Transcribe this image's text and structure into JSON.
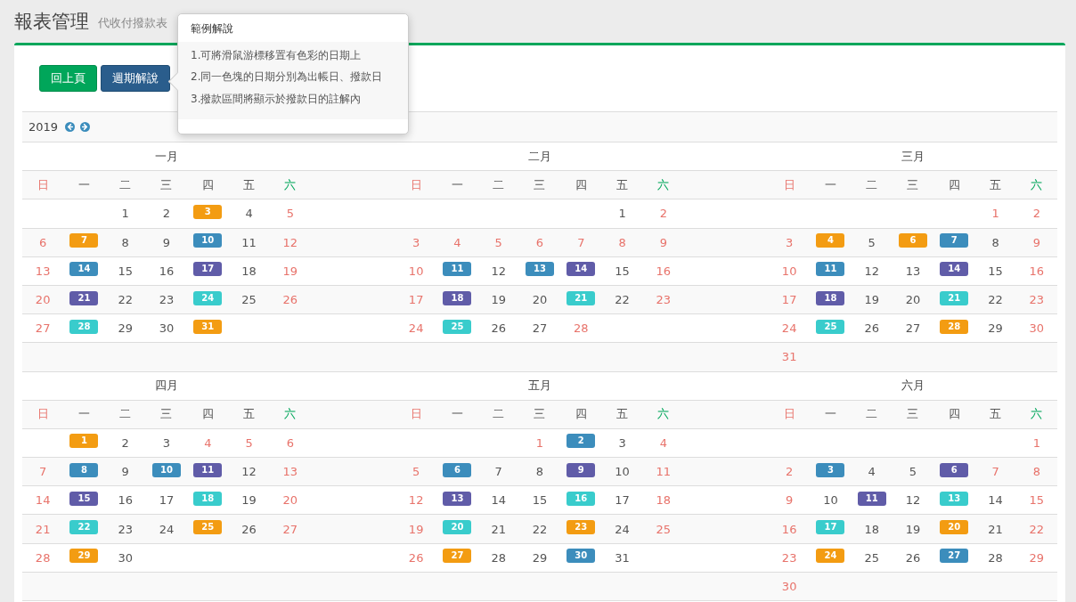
{
  "header": {
    "title": "報表管理",
    "subtitle": "代收付撥款表"
  },
  "buttons": [
    {
      "label": "回上頁",
      "kind": "back"
    },
    {
      "label": "週期解說",
      "kind": "info"
    }
  ],
  "popover": {
    "title": "範例解說",
    "items": [
      "1.可將滑鼠游標移置有色彩的日期上",
      "2.同一色塊的日期分別為出帳日、撥款日",
      "3.撥款區間將顯示於撥款日的註解內"
    ]
  },
  "year": "2019",
  "months": [
    {
      "title": "一月",
      "weekdays": [
        {
          "label": "日",
          "kind": "sun"
        },
        {
          "label": "一",
          "kind": "work"
        },
        {
          "label": "二",
          "kind": "work"
        },
        {
          "label": "三",
          "kind": "work"
        },
        {
          "label": "四",
          "kind": "work"
        },
        {
          "label": "五",
          "kind": "work"
        },
        {
          "label": "六",
          "kind": "sat"
        }
      ],
      "weeks": [
        [
          {
            "kind": "blank"
          },
          {
            "kind": "blank"
          },
          {
            "kind": "day",
            "day": "1",
            "holiday": false
          },
          {
            "kind": "day",
            "day": "2",
            "holiday": false
          },
          {
            "kind": "day",
            "day": "3",
            "holiday": false,
            "color": "#f39c12"
          },
          {
            "kind": "day",
            "day": "4",
            "holiday": false
          },
          {
            "kind": "day",
            "day": "5",
            "holiday": true
          }
        ],
        [
          {
            "kind": "day",
            "day": "6",
            "holiday": true
          },
          {
            "kind": "day",
            "day": "7",
            "holiday": false,
            "color": "#f39c12"
          },
          {
            "kind": "day",
            "day": "8",
            "holiday": false
          },
          {
            "kind": "day",
            "day": "9",
            "holiday": false
          },
          {
            "kind": "day",
            "day": "10",
            "holiday": false,
            "color": "#3c8dbc"
          },
          {
            "kind": "day",
            "day": "11",
            "holiday": false
          },
          {
            "kind": "day",
            "day": "12",
            "holiday": true
          }
        ],
        [
          {
            "kind": "day",
            "day": "13",
            "holiday": true
          },
          {
            "kind": "day",
            "day": "14",
            "holiday": false,
            "color": "#3c8dbc"
          },
          {
            "kind": "day",
            "day": "15",
            "holiday": false
          },
          {
            "kind": "day",
            "day": "16",
            "holiday": false
          },
          {
            "kind": "day",
            "day": "17",
            "holiday": false,
            "color": "#605ca8"
          },
          {
            "kind": "day",
            "day": "18",
            "holiday": false
          },
          {
            "kind": "day",
            "day": "19",
            "holiday": true
          }
        ],
        [
          {
            "kind": "day",
            "day": "20",
            "holiday": true
          },
          {
            "kind": "day",
            "day": "21",
            "holiday": false,
            "color": "#605ca8"
          },
          {
            "kind": "day",
            "day": "22",
            "holiday": false
          },
          {
            "kind": "day",
            "day": "23",
            "holiday": false
          },
          {
            "kind": "day",
            "day": "24",
            "holiday": false,
            "color": "#39cccc"
          },
          {
            "kind": "day",
            "day": "25",
            "holiday": false
          },
          {
            "kind": "day",
            "day": "26",
            "holiday": true
          }
        ],
        [
          {
            "kind": "day",
            "day": "27",
            "holiday": true
          },
          {
            "kind": "day",
            "day": "28",
            "holiday": false,
            "color": "#39cccc"
          },
          {
            "kind": "day",
            "day": "29",
            "holiday": false
          },
          {
            "kind": "day",
            "day": "30",
            "holiday": false
          },
          {
            "kind": "day",
            "day": "31",
            "holiday": false,
            "color": "#f39c12"
          }
        ]
      ]
    },
    {
      "title": "二月",
      "weekdays": [
        {
          "label": "日",
          "kind": "sun"
        },
        {
          "label": "一",
          "kind": "work"
        },
        {
          "label": "二",
          "kind": "work"
        },
        {
          "label": "三",
          "kind": "work"
        },
        {
          "label": "四",
          "kind": "work"
        },
        {
          "label": "五",
          "kind": "work"
        },
        {
          "label": "六",
          "kind": "sat"
        }
      ],
      "weeks": [
        [
          {
            "kind": "blank"
          },
          {
            "kind": "blank"
          },
          {
            "kind": "blank"
          },
          {
            "kind": "blank"
          },
          {
            "kind": "blank"
          },
          {
            "kind": "day",
            "day": "1",
            "holiday": false
          },
          {
            "kind": "day",
            "day": "2",
            "holiday": true
          }
        ],
        [
          {
            "kind": "day",
            "day": "3",
            "holiday": true
          },
          {
            "kind": "day",
            "day": "4",
            "holiday": true
          },
          {
            "kind": "day",
            "day": "5",
            "holiday": true
          },
          {
            "kind": "day",
            "day": "6",
            "holiday": true
          },
          {
            "kind": "day",
            "day": "7",
            "holiday": true
          },
          {
            "kind": "day",
            "day": "8",
            "holiday": true
          },
          {
            "kind": "day",
            "day": "9",
            "holiday": true
          }
        ],
        [
          {
            "kind": "day",
            "day": "10",
            "holiday": true
          },
          {
            "kind": "day",
            "day": "11",
            "holiday": false,
            "color": "#3c8dbc"
          },
          {
            "kind": "day",
            "day": "12",
            "holiday": false
          },
          {
            "kind": "day",
            "day": "13",
            "holiday": false,
            "color": "#3c8dbc"
          },
          {
            "kind": "day",
            "day": "14",
            "holiday": false,
            "color": "#605ca8"
          },
          {
            "kind": "day",
            "day": "15",
            "holiday": false
          },
          {
            "kind": "day",
            "day": "16",
            "holiday": true
          }
        ],
        [
          {
            "kind": "day",
            "day": "17",
            "holiday": true
          },
          {
            "kind": "day",
            "day": "18",
            "holiday": false,
            "color": "#605ca8"
          },
          {
            "kind": "day",
            "day": "19",
            "holiday": false
          },
          {
            "kind": "day",
            "day": "20",
            "holiday": false
          },
          {
            "kind": "day",
            "day": "21",
            "holiday": false,
            "color": "#39cccc"
          },
          {
            "kind": "day",
            "day": "22",
            "holiday": false
          },
          {
            "kind": "day",
            "day": "23",
            "holiday": true
          }
        ],
        [
          {
            "kind": "day",
            "day": "24",
            "holiday": true
          },
          {
            "kind": "day",
            "day": "25",
            "holiday": false,
            "color": "#39cccc"
          },
          {
            "kind": "day",
            "day": "26",
            "holiday": false
          },
          {
            "kind": "day",
            "day": "27",
            "holiday": false
          },
          {
            "kind": "day",
            "day": "28",
            "holiday": true
          }
        ]
      ]
    },
    {
      "title": "三月",
      "weekdays": [
        {
          "label": "日",
          "kind": "sun"
        },
        {
          "label": "一",
          "kind": "work"
        },
        {
          "label": "二",
          "kind": "work"
        },
        {
          "label": "三",
          "kind": "work"
        },
        {
          "label": "四",
          "kind": "work"
        },
        {
          "label": "五",
          "kind": "work"
        },
        {
          "label": "六",
          "kind": "sat"
        }
      ],
      "weeks": [
        [
          {
            "kind": "blank"
          },
          {
            "kind": "blank"
          },
          {
            "kind": "blank"
          },
          {
            "kind": "blank"
          },
          {
            "kind": "blank"
          },
          {
            "kind": "day",
            "day": "1",
            "holiday": true
          },
          {
            "kind": "day",
            "day": "2",
            "holiday": true
          }
        ],
        [
          {
            "kind": "day",
            "day": "3",
            "holiday": true
          },
          {
            "kind": "day",
            "day": "4",
            "holiday": false,
            "color": "#f39c12"
          },
          {
            "kind": "day",
            "day": "5",
            "holiday": false
          },
          {
            "kind": "day",
            "day": "6",
            "holiday": false,
            "color": "#f39c12"
          },
          {
            "kind": "day",
            "day": "7",
            "holiday": false,
            "color": "#3c8dbc"
          },
          {
            "kind": "day",
            "day": "8",
            "holiday": false
          },
          {
            "kind": "day",
            "day": "9",
            "holiday": true
          }
        ],
        [
          {
            "kind": "day",
            "day": "10",
            "holiday": true
          },
          {
            "kind": "day",
            "day": "11",
            "holiday": false,
            "color": "#3c8dbc"
          },
          {
            "kind": "day",
            "day": "12",
            "holiday": false
          },
          {
            "kind": "day",
            "day": "13",
            "holiday": false
          },
          {
            "kind": "day",
            "day": "14",
            "holiday": false,
            "color": "#605ca8"
          },
          {
            "kind": "day",
            "day": "15",
            "holiday": false
          },
          {
            "kind": "day",
            "day": "16",
            "holiday": true
          }
        ],
        [
          {
            "kind": "day",
            "day": "17",
            "holiday": true
          },
          {
            "kind": "day",
            "day": "18",
            "holiday": false,
            "color": "#605ca8"
          },
          {
            "kind": "day",
            "day": "19",
            "holiday": false
          },
          {
            "kind": "day",
            "day": "20",
            "holiday": false
          },
          {
            "kind": "day",
            "day": "21",
            "holiday": false,
            "color": "#39cccc"
          },
          {
            "kind": "day",
            "day": "22",
            "holiday": false
          },
          {
            "kind": "day",
            "day": "23",
            "holiday": true
          }
        ],
        [
          {
            "kind": "day",
            "day": "24",
            "holiday": true
          },
          {
            "kind": "day",
            "day": "25",
            "holiday": false,
            "color": "#39cccc"
          },
          {
            "kind": "day",
            "day": "26",
            "holiday": false
          },
          {
            "kind": "day",
            "day": "27",
            "holiday": false
          },
          {
            "kind": "day",
            "day": "28",
            "holiday": false,
            "color": "#f39c12"
          },
          {
            "kind": "day",
            "day": "29",
            "holiday": false
          },
          {
            "kind": "day",
            "day": "30",
            "holiday": true
          }
        ],
        [
          {
            "kind": "day",
            "day": "31",
            "holiday": true
          }
        ]
      ]
    },
    {
      "title": "四月",
      "weekdays": [
        {
          "label": "日",
          "kind": "sun"
        },
        {
          "label": "一",
          "kind": "work"
        },
        {
          "label": "二",
          "kind": "work"
        },
        {
          "label": "三",
          "kind": "work"
        },
        {
          "label": "四",
          "kind": "work"
        },
        {
          "label": "五",
          "kind": "work"
        },
        {
          "label": "六",
          "kind": "sat"
        }
      ],
      "weeks": [
        [
          {
            "kind": "blank"
          },
          {
            "kind": "day",
            "day": "1",
            "holiday": false,
            "color": "#f39c12"
          },
          {
            "kind": "day",
            "day": "2",
            "holiday": false
          },
          {
            "kind": "day",
            "day": "3",
            "holiday": false
          },
          {
            "kind": "day",
            "day": "4",
            "holiday": true
          },
          {
            "kind": "day",
            "day": "5",
            "holiday": true
          },
          {
            "kind": "day",
            "day": "6",
            "holiday": true
          }
        ],
        [
          {
            "kind": "day",
            "day": "7",
            "holiday": true
          },
          {
            "kind": "day",
            "day": "8",
            "holiday": false,
            "color": "#3c8dbc"
          },
          {
            "kind": "day",
            "day": "9",
            "holiday": false
          },
          {
            "kind": "day",
            "day": "10",
            "holiday": false,
            "color": "#3c8dbc"
          },
          {
            "kind": "day",
            "day": "11",
            "holiday": false,
            "color": "#605ca8"
          },
          {
            "kind": "day",
            "day": "12",
            "holiday": false
          },
          {
            "kind": "day",
            "day": "13",
            "holiday": true
          }
        ],
        [
          {
            "kind": "day",
            "day": "14",
            "holiday": true
          },
          {
            "kind": "day",
            "day": "15",
            "holiday": false,
            "color": "#605ca8"
          },
          {
            "kind": "day",
            "day": "16",
            "holiday": false
          },
          {
            "kind": "day",
            "day": "17",
            "holiday": false
          },
          {
            "kind": "day",
            "day": "18",
            "holiday": false,
            "color": "#39cccc"
          },
          {
            "kind": "day",
            "day": "19",
            "holiday": false
          },
          {
            "kind": "day",
            "day": "20",
            "holiday": true
          }
        ],
        [
          {
            "kind": "day",
            "day": "21",
            "holiday": true
          },
          {
            "kind": "day",
            "day": "22",
            "holiday": false,
            "color": "#39cccc"
          },
          {
            "kind": "day",
            "day": "23",
            "holiday": false
          },
          {
            "kind": "day",
            "day": "24",
            "holiday": false
          },
          {
            "kind": "day",
            "day": "25",
            "holiday": false,
            "color": "#f39c12"
          },
          {
            "kind": "day",
            "day": "26",
            "holiday": false
          },
          {
            "kind": "day",
            "day": "27",
            "holiday": true
          }
        ],
        [
          {
            "kind": "day",
            "day": "28",
            "holiday": true
          },
          {
            "kind": "day",
            "day": "29",
            "holiday": false,
            "color": "#f39c12"
          },
          {
            "kind": "day",
            "day": "30",
            "holiday": false
          }
        ]
      ]
    },
    {
      "title": "五月",
      "weekdays": [
        {
          "label": "日",
          "kind": "sun"
        },
        {
          "label": "一",
          "kind": "work"
        },
        {
          "label": "二",
          "kind": "work"
        },
        {
          "label": "三",
          "kind": "work"
        },
        {
          "label": "四",
          "kind": "work"
        },
        {
          "label": "五",
          "kind": "work"
        },
        {
          "label": "六",
          "kind": "sat"
        }
      ],
      "weeks": [
        [
          {
            "kind": "blank"
          },
          {
            "kind": "blank"
          },
          {
            "kind": "blank"
          },
          {
            "kind": "day",
            "day": "1",
            "holiday": true
          },
          {
            "kind": "day",
            "day": "2",
            "holiday": false,
            "color": "#3c8dbc"
          },
          {
            "kind": "day",
            "day": "3",
            "holiday": false
          },
          {
            "kind": "day",
            "day": "4",
            "holiday": true
          }
        ],
        [
          {
            "kind": "day",
            "day": "5",
            "holiday": true
          },
          {
            "kind": "day",
            "day": "6",
            "holiday": false,
            "color": "#3c8dbc"
          },
          {
            "kind": "day",
            "day": "7",
            "holiday": false
          },
          {
            "kind": "day",
            "day": "8",
            "holiday": false
          },
          {
            "kind": "day",
            "day": "9",
            "holiday": false,
            "color": "#605ca8"
          },
          {
            "kind": "day",
            "day": "10",
            "holiday": false
          },
          {
            "kind": "day",
            "day": "11",
            "holiday": true
          }
        ],
        [
          {
            "kind": "day",
            "day": "12",
            "holiday": true
          },
          {
            "kind": "day",
            "day": "13",
            "holiday": false,
            "color": "#605ca8"
          },
          {
            "kind": "day",
            "day": "14",
            "holiday": false
          },
          {
            "kind": "day",
            "day": "15",
            "holiday": false
          },
          {
            "kind": "day",
            "day": "16",
            "holiday": false,
            "color": "#39cccc"
          },
          {
            "kind": "day",
            "day": "17",
            "holiday": false
          },
          {
            "kind": "day",
            "day": "18",
            "holiday": true
          }
        ],
        [
          {
            "kind": "day",
            "day": "19",
            "holiday": true
          },
          {
            "kind": "day",
            "day": "20",
            "holiday": false,
            "color": "#39cccc"
          },
          {
            "kind": "day",
            "day": "21",
            "holiday": false
          },
          {
            "kind": "day",
            "day": "22",
            "holiday": false
          },
          {
            "kind": "day",
            "day": "23",
            "holiday": false,
            "color": "#f39c12"
          },
          {
            "kind": "day",
            "day": "24",
            "holiday": false
          },
          {
            "kind": "day",
            "day": "25",
            "holiday": true
          }
        ],
        [
          {
            "kind": "day",
            "day": "26",
            "holiday": true
          },
          {
            "kind": "day",
            "day": "27",
            "holiday": false,
            "color": "#f39c12"
          },
          {
            "kind": "day",
            "day": "28",
            "holiday": false
          },
          {
            "kind": "day",
            "day": "29",
            "holiday": false
          },
          {
            "kind": "day",
            "day": "30",
            "holiday": false,
            "color": "#3c8dbc"
          },
          {
            "kind": "day",
            "day": "31",
            "holiday": false
          }
        ]
      ]
    },
    {
      "title": "六月",
      "weekdays": [
        {
          "label": "日",
          "kind": "sun"
        },
        {
          "label": "一",
          "kind": "work"
        },
        {
          "label": "二",
          "kind": "work"
        },
        {
          "label": "三",
          "kind": "work"
        },
        {
          "label": "四",
          "kind": "work"
        },
        {
          "label": "五",
          "kind": "work"
        },
        {
          "label": "六",
          "kind": "sat"
        }
      ],
      "weeks": [
        [
          {
            "kind": "blank"
          },
          {
            "kind": "blank"
          },
          {
            "kind": "blank"
          },
          {
            "kind": "blank"
          },
          {
            "kind": "blank"
          },
          {
            "kind": "blank"
          },
          {
            "kind": "day",
            "day": "1",
            "holiday": true
          }
        ],
        [
          {
            "kind": "day",
            "day": "2",
            "holiday": true
          },
          {
            "kind": "day",
            "day": "3",
            "holiday": false,
            "color": "#3c8dbc"
          },
          {
            "kind": "day",
            "day": "4",
            "holiday": false
          },
          {
            "kind": "day",
            "day": "5",
            "holiday": false
          },
          {
            "kind": "day",
            "day": "6",
            "holiday": false,
            "color": "#605ca8"
          },
          {
            "kind": "day",
            "day": "7",
            "holiday": true
          },
          {
            "kind": "day",
            "day": "8",
            "holiday": true
          }
        ],
        [
          {
            "kind": "day",
            "day": "9",
            "holiday": true
          },
          {
            "kind": "day",
            "day": "10",
            "holiday": false
          },
          {
            "kind": "day",
            "day": "11",
            "holiday": false,
            "color": "#605ca8"
          },
          {
            "kind": "day",
            "day": "12",
            "holiday": false
          },
          {
            "kind": "day",
            "day": "13",
            "holiday": false,
            "color": "#39cccc"
          },
          {
            "kind": "day",
            "day": "14",
            "holiday": false
          },
          {
            "kind": "day",
            "day": "15",
            "holiday": true
          }
        ],
        [
          {
            "kind": "day",
            "day": "16",
            "holiday": true
          },
          {
            "kind": "day",
            "day": "17",
            "holiday": false,
            "color": "#39cccc"
          },
          {
            "kind": "day",
            "day": "18",
            "holiday": false
          },
          {
            "kind": "day",
            "day": "19",
            "holiday": false
          },
          {
            "kind": "day",
            "day": "20",
            "holiday": false,
            "color": "#f39c12"
          },
          {
            "kind": "day",
            "day": "21",
            "holiday": false
          },
          {
            "kind": "day",
            "day": "22",
            "holiday": true
          }
        ],
        [
          {
            "kind": "day",
            "day": "23",
            "holiday": true
          },
          {
            "kind": "day",
            "day": "24",
            "holiday": false,
            "color": "#f39c12"
          },
          {
            "kind": "day",
            "day": "25",
            "holiday": false
          },
          {
            "kind": "day",
            "day": "26",
            "holiday": false
          },
          {
            "kind": "day",
            "day": "27",
            "holiday": false,
            "color": "#3c8dbc"
          },
          {
            "kind": "day",
            "day": "28",
            "holiday": false
          },
          {
            "kind": "day",
            "day": "29",
            "holiday": true
          }
        ],
        [
          {
            "kind": "day",
            "day": "30",
            "holiday": true
          }
        ]
      ]
    }
  ]
}
